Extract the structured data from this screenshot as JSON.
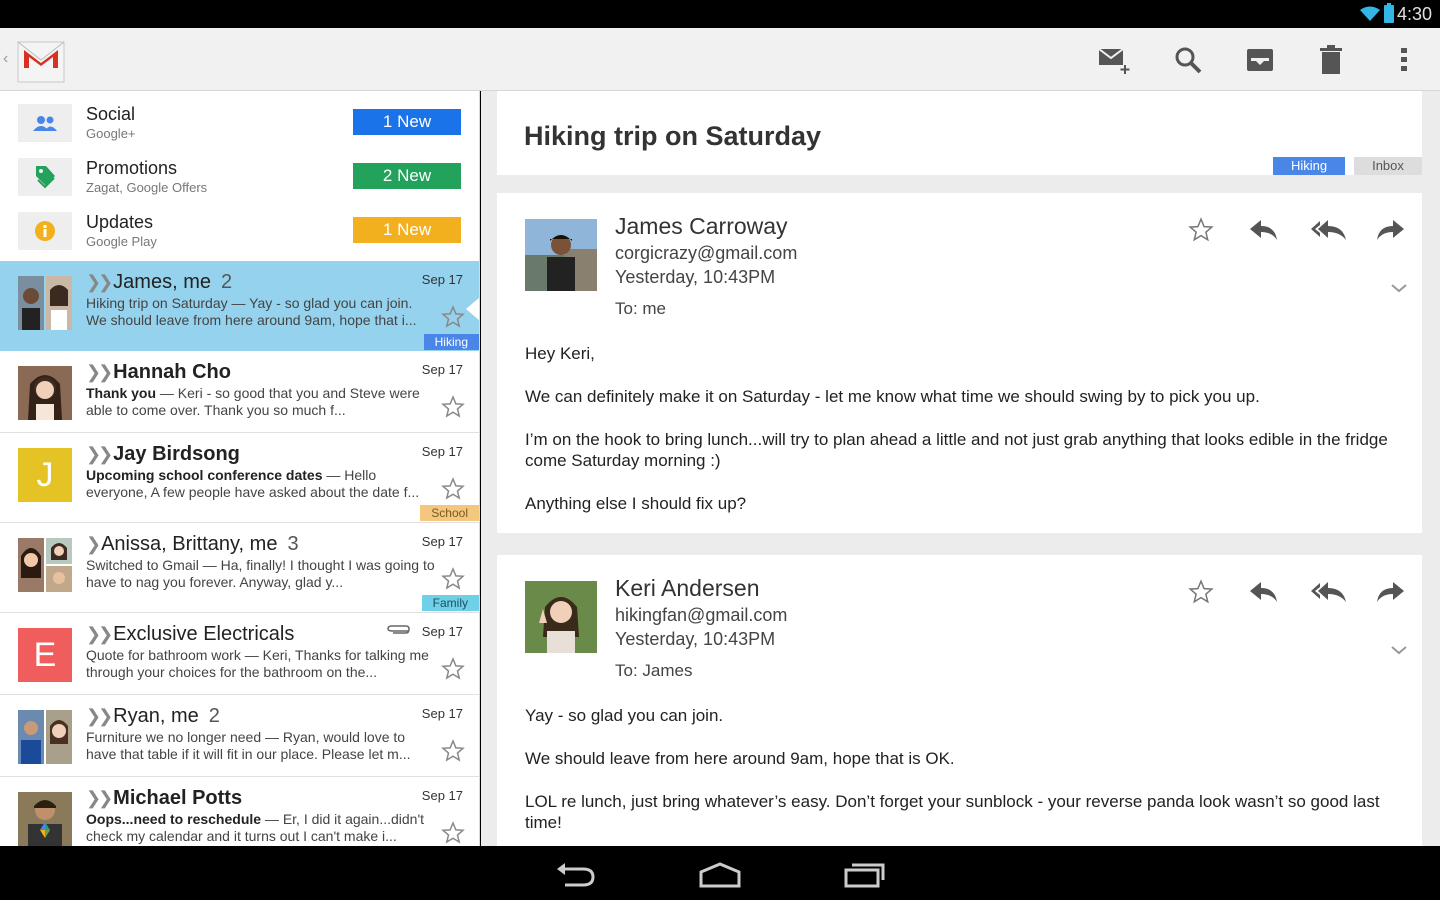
{
  "status_bar": {
    "time": "4:30"
  },
  "action_bar": {
    "icons": [
      "compose-icon",
      "search-icon",
      "archive-icon",
      "delete-icon",
      "overflow-menu-icon"
    ]
  },
  "categories": [
    {
      "name": "Social",
      "sub": "Google+",
      "badge": "1 New",
      "color": "#1a73e8"
    },
    {
      "name": "Promotions",
      "sub": "Zagat, Google Offers",
      "badge": "2 New",
      "color": "#22a25a"
    },
    {
      "name": "Updates",
      "sub": "Google Play",
      "badge": "1 New",
      "color": "#f2b01e"
    }
  ],
  "conversations": [
    {
      "sender": "James, me",
      "count": "2",
      "date": "Sep 17",
      "subject": "Hiking trip on Saturday",
      "snippet": " — Yay - so glad you can join. We should leave from here around 9am, hope that i...",
      "label": "Hiking",
      "label_color": "#4a86e8",
      "selected": true
    },
    {
      "sender": "Hannah Cho",
      "count": "",
      "date": "Sep 17",
      "subject": "Thank you",
      "snippet": " — Keri - so good that you and Steve were able to come over. Thank you so much f...",
      "label": ""
    },
    {
      "sender": "Jay Birdsong",
      "count": "",
      "date": "Sep 17",
      "subject": "Upcoming school conference dates",
      "snippet": " — Hello everyone, A few people have asked about the date f...",
      "label": "School",
      "label_color": "#f3c77d",
      "avatar_letter": "J",
      "avatar_color": "#e5c325"
    },
    {
      "sender": "Anissa, Brittany, me",
      "count": "3",
      "date": "Sep 17",
      "subject": "Switched to Gmail",
      "snippet": " — Ha, finally! I thought I was going to have to nag you forever. Anyway, glad y...",
      "label": "Family",
      "label_color": "#6fd0e8"
    },
    {
      "sender": "Exclusive Electricals",
      "count": "",
      "date": "Sep 17",
      "subject": "Quote for bathroom work",
      "snippet": " — Keri, Thanks for talking me through your choices for the bathroom on the...",
      "label": "",
      "avatar_letter": "E",
      "avatar_color": "#f05d5d"
    },
    {
      "sender": "Ryan, me",
      "count": "2",
      "date": "Sep 17",
      "subject": "Furniture we no longer need",
      "snippet": " — Ryan, would love to have that table if it will fit in our place. Please let m...",
      "label": ""
    },
    {
      "sender": "Michael Potts",
      "count": "",
      "date": "Sep 17",
      "subject": "Oops...need to reschedule",
      "snippet": " — Er, I did it again...didn't check my calendar and it turns out I can't make i...",
      "label": ""
    }
  ],
  "thread": {
    "subject": "Hiking trip on Saturday",
    "tags": [
      "Hiking",
      "Inbox"
    ],
    "messages": [
      {
        "from": "James Carroway",
        "email": "corgicrazy@gmail.com",
        "time": "Yesterday, 10:43PM",
        "to": "To: me",
        "body": [
          "Hey Keri,",
          "We can definitely make it on Saturday - let me know what time we should swing by to pick you up.",
          "I’m on the hook to bring lunch...will try to plan ahead a little and not just grab anything that looks edible in the fridge come Saturday morning :)",
          "Anything else I should fix up?"
        ]
      },
      {
        "from": "Keri Andersen",
        "email": "hikingfan@gmail.com",
        "time": "Yesterday, 10:43PM",
        "to": "To: James",
        "body": [
          "Yay - so glad you can join.",
          "We should leave from here around 9am, hope that is OK.",
          "LOL re lunch, just bring whatever’s easy. Don’t forget your sunblock - your reverse panda look wasn’t so good last time!"
        ]
      }
    ]
  }
}
